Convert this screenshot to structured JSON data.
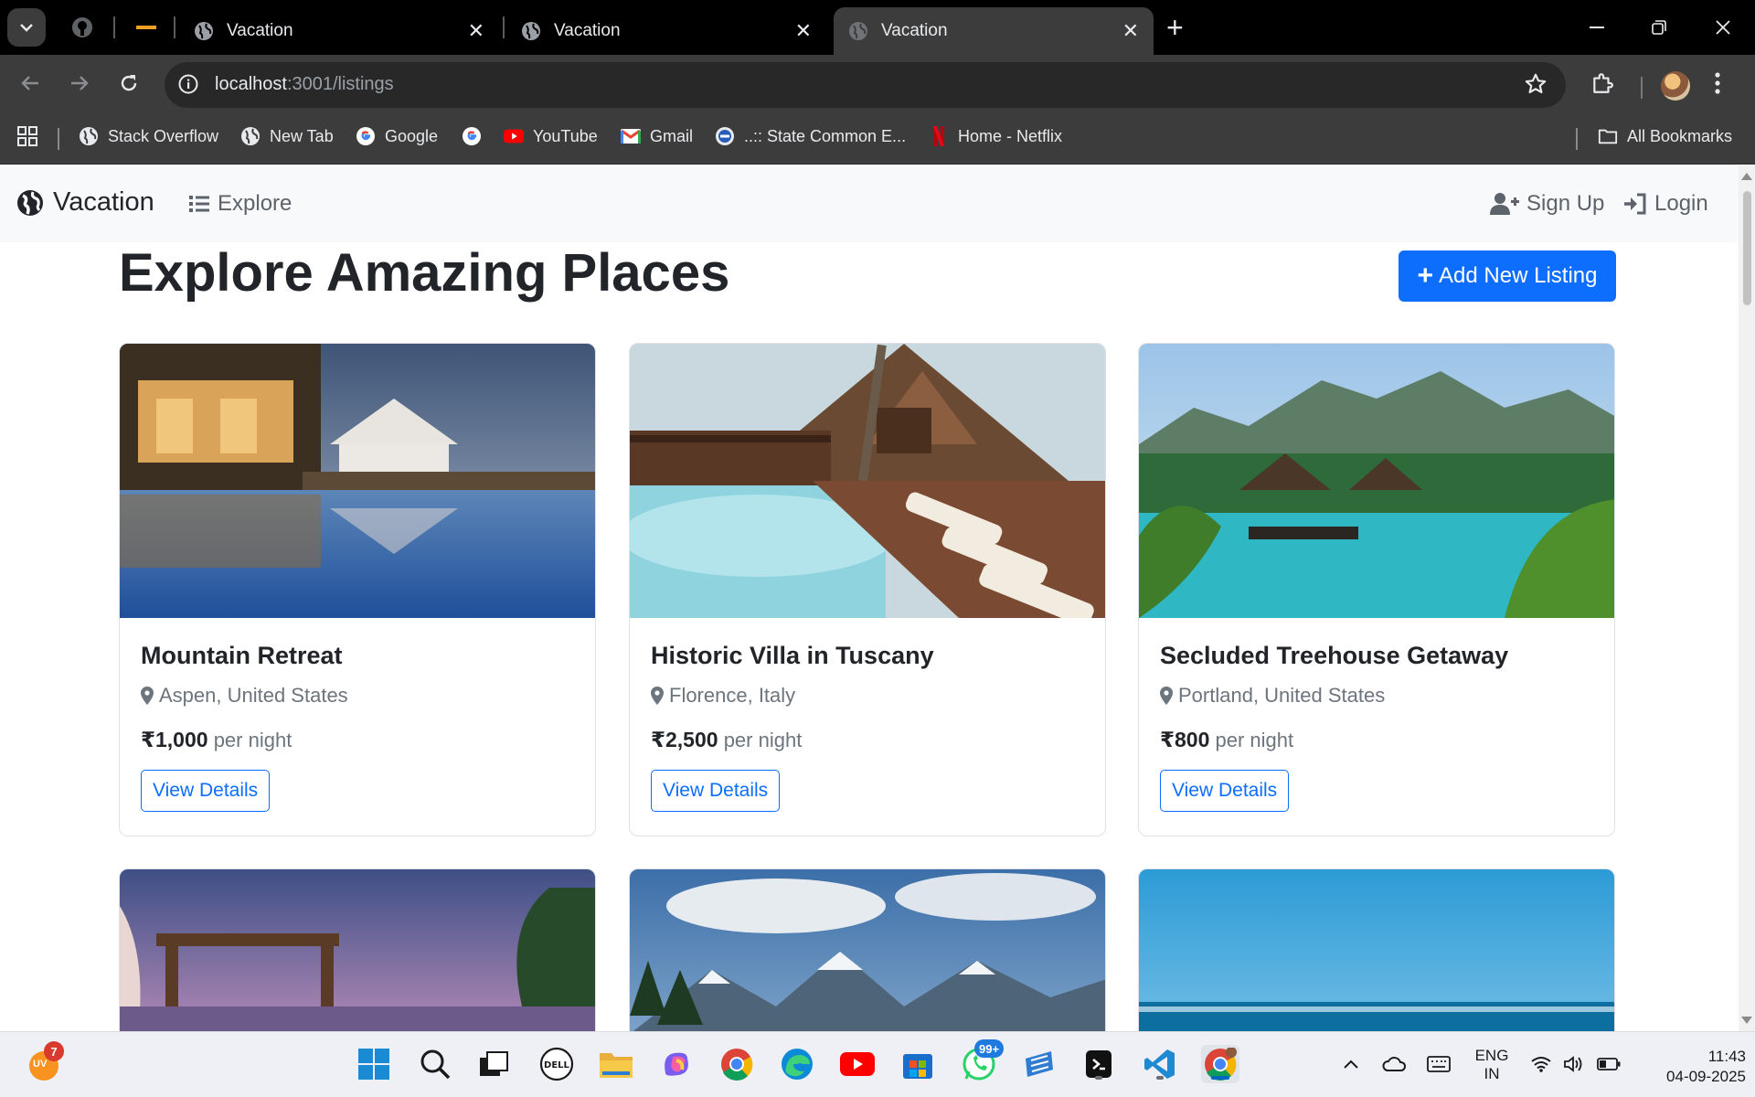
{
  "browser": {
    "tabs": [
      {
        "title": "Vacation"
      },
      {
        "title": "Vacation"
      },
      {
        "title": "Vacation"
      }
    ],
    "url_host": "localhost",
    "url_rest": ":3001/listings",
    "bookmarks": [
      {
        "label": "Stack Overflow"
      },
      {
        "label": "New Tab"
      },
      {
        "label": "Google"
      },
      {
        "label": "YouTube"
      },
      {
        "label": "Gmail"
      },
      {
        "label": "..:: State Common E..."
      },
      {
        "label": "Home - Netflix"
      }
    ],
    "all_bookmarks": "All Bookmarks"
  },
  "site": {
    "brand": "Vacation",
    "nav_explore": "Explore",
    "nav_signup": "Sign Up",
    "nav_login": "Login",
    "heading": "Explore Amazing Places",
    "add_listing": "Add New Listing",
    "listings": [
      {
        "title": "Mountain Retreat",
        "location": "Aspen, United States",
        "price": "₹1,000",
        "per": "per night",
        "button": "View Details"
      },
      {
        "title": "Historic Villa in Tuscany",
        "location": "Florence, Italy",
        "price": "₹2,500",
        "per": "per night",
        "button": "View Details"
      },
      {
        "title": "Secluded Treehouse Getaway",
        "location": "Portland, United States",
        "price": "₹800",
        "per": "per night",
        "button": "View Details"
      }
    ]
  },
  "taskbar": {
    "weather_badge": "7",
    "weather_initials": "UV",
    "whatsapp_badge": "99+",
    "lang_top": "ENG",
    "lang_bottom": "IN",
    "time": "11:43",
    "date": "04-09-2025"
  },
  "colors": {
    "primary": "#0d6efd",
    "chrome_dark": "#3c3c3c",
    "navbar_bg": "#f8f9fa"
  }
}
